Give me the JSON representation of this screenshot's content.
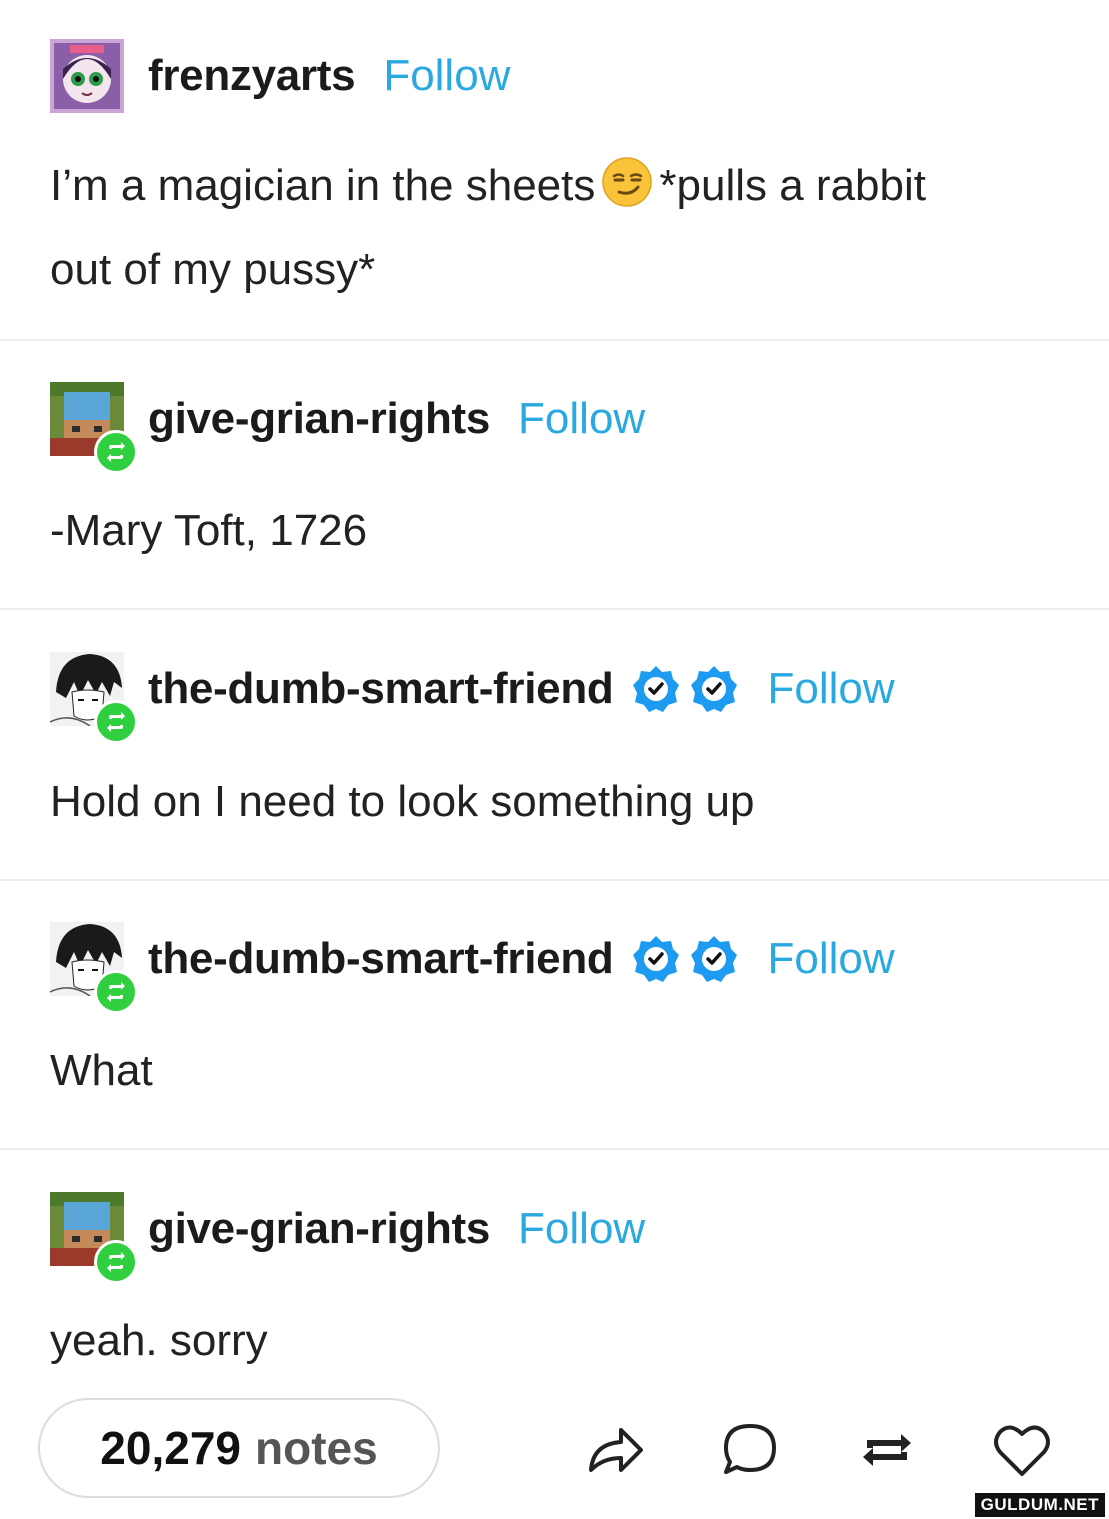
{
  "posts": [
    {
      "username": "frenzyarts",
      "follow_label": "Follow",
      "text_part1": "I’m a magician in the sheets",
      "text_part2": "*pulls a rabbit",
      "text_line2": "out of my pussy*"
    },
    {
      "username": "give-grian-rights",
      "follow_label": "Follow",
      "text": "-Mary Toft, 1726"
    },
    {
      "username": "the-dumb-smart-friend",
      "follow_label": "Follow",
      "text": "Hold on I need to look something up"
    },
    {
      "username": "the-dumb-smart-friend",
      "follow_label": "Follow",
      "text": "What"
    },
    {
      "username": "give-grian-rights",
      "follow_label": "Follow",
      "text": "yeah. sorry"
    }
  ],
  "footer": {
    "notes_count": "20,279",
    "notes_label": "notes"
  },
  "watermark": "GULDUM.NET",
  "colors": {
    "follow": "#2aa9e0",
    "reblog_badge": "#2fcf3f",
    "verified": "#1d9bf0",
    "divider": "#ececec"
  },
  "icons": [
    "smirk-emoji",
    "reblog-icon",
    "verified-badge-icon",
    "share-icon",
    "reply-icon",
    "reblog-action-icon",
    "heart-icon"
  ]
}
